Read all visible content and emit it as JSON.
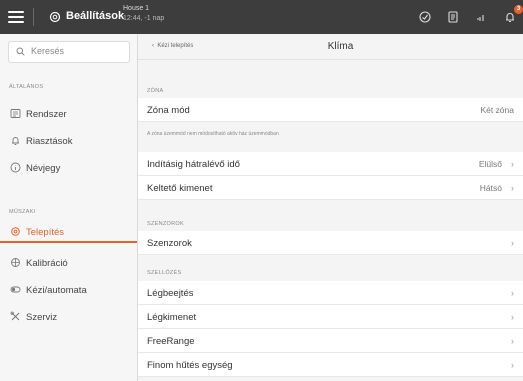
{
  "topbar": {
    "title": "Beállítások",
    "house_name": "House 1",
    "house_status": "12:44, -1 nap",
    "alert_count": "3"
  },
  "sidebar": {
    "search_placeholder": "Keresés",
    "section_general": "ÁLTALÁNOS",
    "section_technical": "MŰSZAKI",
    "items": [
      {
        "label": "Rendszer",
        "icon": "system-icon"
      },
      {
        "label": "Riasztások",
        "icon": "bell-icon"
      },
      {
        "label": "Névjegy",
        "icon": "info-icon"
      },
      {
        "label": "Telepítés",
        "icon": "install-icon",
        "active": true
      },
      {
        "label": "Kalibráció",
        "icon": "calibration-icon"
      },
      {
        "label": "Kézi/automata",
        "icon": "toggle-icon"
      },
      {
        "label": "Szerviz",
        "icon": "tools-icon"
      }
    ]
  },
  "main": {
    "back_label": "Kézi telepítés",
    "page_title": "Klíma",
    "section_zone": "ZÓNA",
    "zone_mode_label": "Zóna mód",
    "zone_mode_value": "Két zóna",
    "zone_hint": "A zóna üzemmód nem módosítható aktív ház üzemmódban",
    "start_delay_label": "Indításig hátralévő idő",
    "start_delay_value": "Elülső",
    "output_label": "Keltető kimenet",
    "output_value": "Hátsó",
    "section_sensors": "SZENZOROK",
    "sensors_label": "Szenzorok",
    "section_ventilation": "SZELLŐZÉS",
    "air_inlet_label": "Légbeejtés",
    "air_outlet_label": "Légkimenet",
    "freerange_label": "FreeRange",
    "cooling_label": "Finom hűtés egység"
  },
  "colors": {
    "accent": "#e8612c",
    "topbar": "#3d3d3d"
  }
}
